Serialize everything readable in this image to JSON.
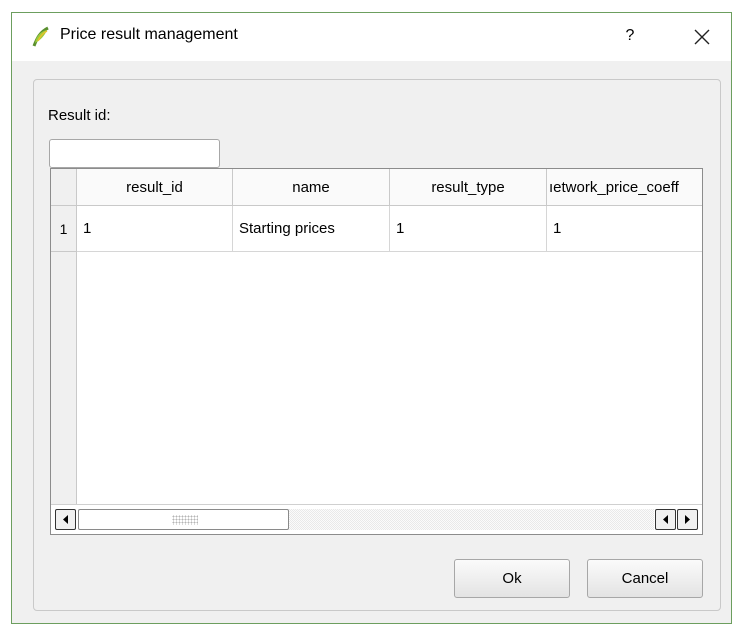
{
  "window": {
    "title": "Price result management",
    "help_label": "?",
    "accent_color": "#6c9e5e"
  },
  "form": {
    "result_id_label": "Result id:",
    "result_id_value": "",
    "result_id_placeholder": ""
  },
  "table": {
    "columns": [
      "result_id",
      "name",
      "result_type",
      "ıetwork_price_coeff"
    ],
    "rows": [
      {
        "row_label": "1",
        "cells": [
          "1",
          "Starting prices",
          "1",
          "1"
        ]
      }
    ]
  },
  "buttons": {
    "ok_label": "Ok",
    "cancel_label": "Cancel"
  },
  "icons": {
    "app": "qgis-app-icon",
    "close": "close-icon",
    "scroll_left": "scroll-left-arrow-icon",
    "scroll_right": "scroll-right-arrow-icon"
  }
}
